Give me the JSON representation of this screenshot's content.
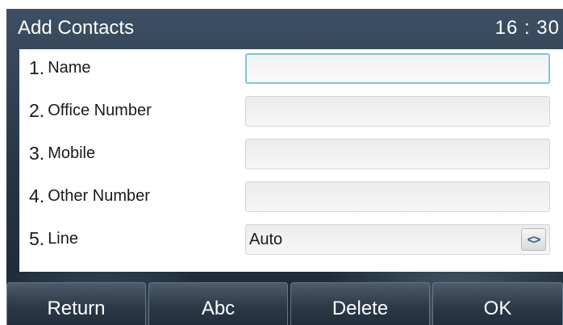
{
  "title_bar": {
    "title": "Add Contacts",
    "time": "16 : 30"
  },
  "form": {
    "rows": [
      {
        "number": "1.",
        "label": "Name",
        "type": "text",
        "value": ""
      },
      {
        "number": "2.",
        "label": "Office Number",
        "type": "text",
        "value": ""
      },
      {
        "number": "3.",
        "label": "Mobile",
        "type": "text",
        "value": ""
      },
      {
        "number": "4.",
        "label": "Other Number",
        "type": "text",
        "value": ""
      },
      {
        "number": "5.",
        "label": "Line",
        "type": "select",
        "value": "Auto",
        "control_glyph": "<>"
      }
    ]
  },
  "softkeys": [
    {
      "label": "Return"
    },
    {
      "label": "Abc"
    },
    {
      "label": "Delete"
    },
    {
      "label": "OK"
    }
  ],
  "colors": {
    "active_field_border": "#7fc4dc",
    "arrow_glyph": "#1f5f7c"
  }
}
